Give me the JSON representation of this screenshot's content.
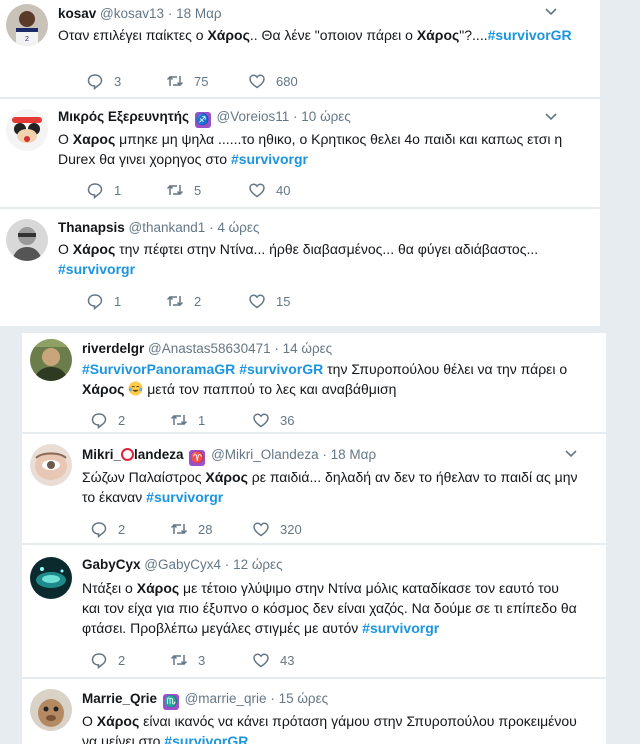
{
  "icons": {
    "reply": "reply-icon",
    "retweet": "retweet-icon",
    "like": "heart-icon",
    "more": "chevron-down-icon"
  },
  "colors": {
    "hashtag": "#1b95e0",
    "secondary": "#657786",
    "separator": "#e6ecf0",
    "badge": "#9b4fcb"
  },
  "tweets": [
    {
      "name": "kosav",
      "handle": "@kosav13",
      "time": "18 Μαρ",
      "text": [
        "Οταν επιλέγει παίκτες ο ",
        {
          "b": "Χάρος"
        },
        ".. Θα λένε \"οποιον πάρει ο ",
        {
          "b": "Χάρος"
        },
        "\"?....",
        {
          "tag": "#survivorGR"
        }
      ],
      "replies": "3",
      "retweets": "75",
      "likes": "680"
    },
    {
      "name": "Μικρός Εξερευνητής",
      "badge": "♐",
      "handle": "@Voreios11",
      "time": "10 ώρες",
      "text": [
        "Ο ",
        {
          "b": "Χαρος"
        },
        " μπηκε μη ψηλα ......το ηθικο, ο Κρητικος θελει 4ο παιδι και καπως ετσι η Durex θα γινει χορηγος στο  ",
        {
          "tag": "#survivorgr"
        }
      ],
      "replies": "1",
      "retweets": "5",
      "likes": "40"
    },
    {
      "name": "Thanapsis",
      "handle": "@thankand1",
      "time": "4 ώρες",
      "text": [
        "Ο ",
        {
          "b": "Χάρος"
        },
        " την πέφτει στην Ντίνα... ήρθε διαβασμένος... θα φύγει αδιάβαστος... ",
        {
          "tag": "#survivorgr"
        }
      ],
      "replies": "1",
      "retweets": "2",
      "likes": "15"
    },
    {
      "name": "riverdelgr",
      "handle": "@Anastas58630471",
      "time": "14 ώρες",
      "text": [
        {
          "tag": "#SurvivorPanoramaGR"
        },
        " ",
        {
          "tag": "#survivorGR"
        },
        " την Σπυροπούλου θέλει να την πάρει ο ",
        {
          "b": "Χάρος"
        },
        " ",
        {
          "emoji": "joy"
        },
        " μετά τον παππού το λες και αναβάθμιση"
      ],
      "replies": "2",
      "retweets": "1",
      "likes": "36"
    },
    {
      "name_pre": "Mikri_",
      "name_post": "landeza",
      "badge": "♈",
      "handle": "@Mikri_Olandeza",
      "time": "18 Μαρ",
      "text": [
        "Σώζων Παλαίστρος ",
        {
          "b": "Χάρος"
        },
        " ρε παιδιά...  δηλαδή αν δεν το ήθελαν το παιδί ας μην το έκαναν ",
        {
          "tag": "#survivorgr"
        }
      ],
      "replies": "2",
      "retweets": "28",
      "likes": "320"
    },
    {
      "name": "GabyCyx",
      "handle": "@GabyCyx4",
      "time": "12 ώρες",
      "text": [
        "Ντάξει ο ",
        {
          "b": "Χάρος"
        },
        " με τέτοιο γλύψιμο στην Ντίνα μόλις καταδίκασε τον εαυτό του και τον είχα για πιο έξυπνο ο κόσμος δεν είναι χαζός. Να δούμε σε τι επίπεδο θα φτάσει. Προβλέπω μεγάλες στιγμές με αυτόν ",
        {
          "tag": "#survivorgr"
        }
      ],
      "replies": "2",
      "retweets": "3",
      "likes": "43"
    },
    {
      "name": "Marrie_Qrie",
      "badge": "♏",
      "handle": "@marrie_qrie",
      "time": "15 ώρες",
      "text": [
        "Ο ",
        {
          "b": "Χάρος"
        },
        " είναι ικανός να κάνει πρόταση γάμου στην Σπυροπούλου προκειμένου να μείνει στο ",
        {
          "tag": "#survivorGR"
        },
        "."
      ],
      "replies": "",
      "retweets": "",
      "likes": ""
    }
  ]
}
